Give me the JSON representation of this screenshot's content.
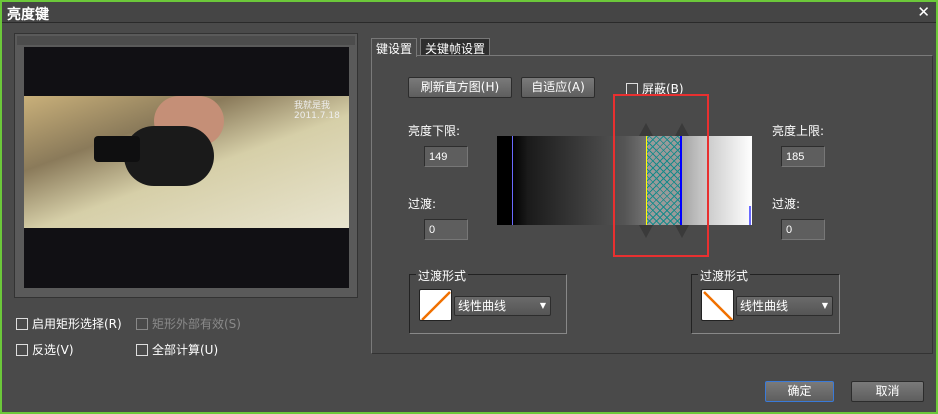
{
  "window": {
    "title": "亮度键",
    "close": "✕"
  },
  "preview": {
    "caption": "我就是我\n2011.7.18"
  },
  "options": {
    "enable_rect": "启用矩形选择(R)",
    "rect_outside": "矩形外部有效(S)",
    "invert": "反选(V)",
    "compute_all": "全部计算(U)"
  },
  "tabs": [
    {
      "label": "键设置"
    },
    {
      "label": "关键帧设置"
    }
  ],
  "key": {
    "refresh_button": "刷新直方图(H)",
    "auto_button": "自适应(A)",
    "mask_label": "屏蔽(B)",
    "lower_label": "亮度下限:",
    "lower_value": "149",
    "lower_trans_label": "过渡:",
    "lower_trans_value": "0",
    "upper_label": "亮度上限:",
    "upper_value": "185",
    "upper_trans_label": "过渡:",
    "upper_trans_value": "0",
    "left_group": {
      "title": "过渡形式",
      "value": "线性曲线"
    },
    "right_group": {
      "title": "过渡形式",
      "value": "线性曲线"
    }
  },
  "footer": {
    "ok": "确定",
    "cancel": "取消"
  },
  "colors": {
    "highlight": "#e83030",
    "lower_marker": "#ffff00",
    "upper_marker": "#0000ff",
    "curve": "#f07000"
  }
}
